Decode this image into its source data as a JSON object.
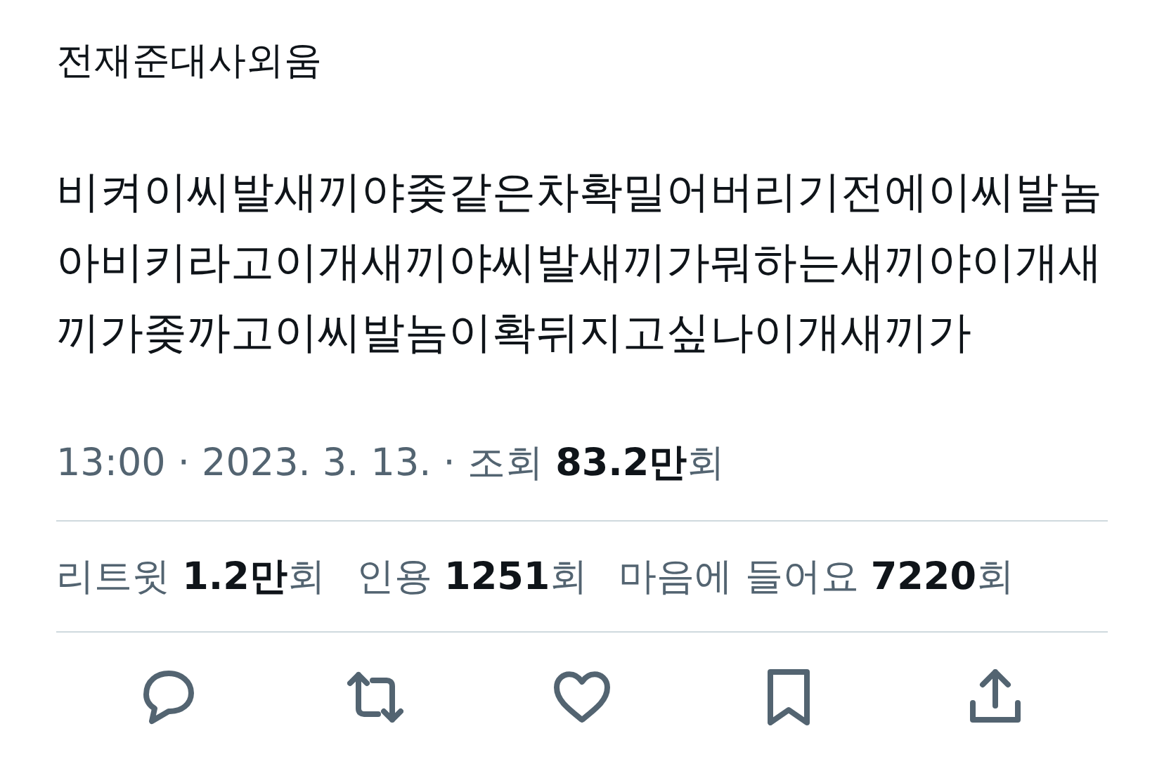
{
  "author_line": "전재준대사외움",
  "body_lines": [
    "비켜이씨발새끼야좆같은차확밀어버리기전에이씨발놈",
    "아비키라고이개새끼야씨발새끼가뭐하는새끼야이개새",
    "끼가좆까고이씨발놈이확뒤지고싶나이개새끼가"
  ],
  "meta": "13:00 · 2023. 3. 13. · 조회 **83.2만**회",
  "stats": [
    "리트윗 **1.2만**회",
    "인용 **1251**회",
    "마음에 들어요 **7220**회"
  ],
  "actions": [
    {
      "kind": "reply"
    },
    {
      "kind": "retweet"
    },
    {
      "kind": "like"
    },
    {
      "kind": "bookmark"
    },
    {
      "kind": "share"
    }
  ]
}
